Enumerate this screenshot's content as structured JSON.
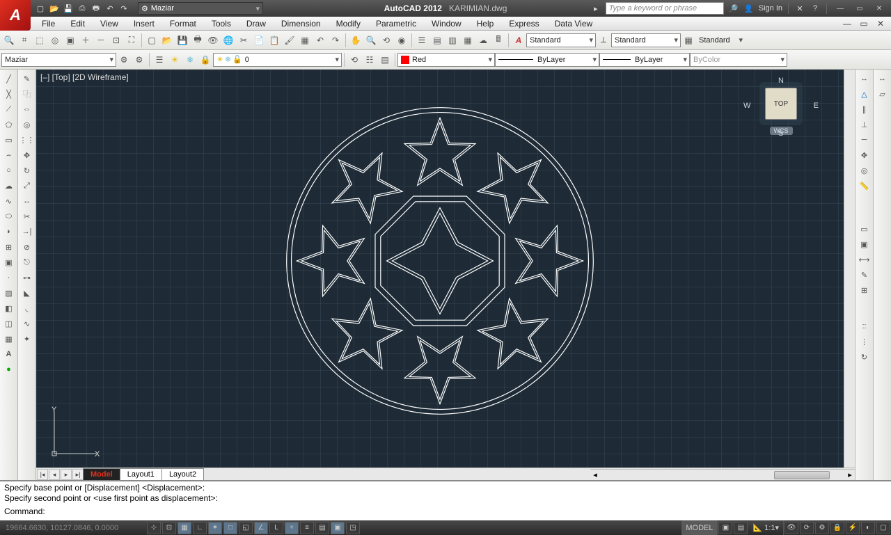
{
  "app": {
    "title_a": "AutoCAD 2012",
    "title_b": "KARIMIAN.dwg",
    "logo": "A"
  },
  "quick_access": {
    "workspace": "Maziar"
  },
  "search": {
    "placeholder": "Type a keyword or phrase",
    "signin": "Sign In"
  },
  "menus": [
    "File",
    "Edit",
    "View",
    "Insert",
    "Format",
    "Tools",
    "Draw",
    "Dimension",
    "Modify",
    "Parametric",
    "Window",
    "Help",
    "Express",
    "Data View"
  ],
  "row2": {
    "workspace_dd": "Maziar",
    "layer_dd": "0",
    "color_dd": "Red",
    "linetype_dd": "ByLayer",
    "lineweight_dd": "ByLayer",
    "plotstyle_dd": "ByColor",
    "textstyle_a": "Standard",
    "textstyle_b": "Standard",
    "textstyle_c": "Standard"
  },
  "canvas": {
    "label": "[–] [Top] [2D Wireframe]",
    "viewcube": "TOP",
    "wcs": "WCS",
    "ucs_x": "X",
    "ucs_y": "Y",
    "dir_n": "N",
    "dir_s": "S",
    "dir_e": "E",
    "dir_w": "W"
  },
  "tabs": {
    "model": "Model",
    "l1": "Layout1",
    "l2": "Layout2"
  },
  "command": {
    "l1": "Specify base point or [Displacement] <Displacement>:",
    "l2": "Specify second point or <use first point as displacement>:",
    "l3": "Command:"
  },
  "status": {
    "coords": "19664.6630, 10127.0846, 0.0000",
    "space": "MODEL",
    "scale": "1:1"
  }
}
